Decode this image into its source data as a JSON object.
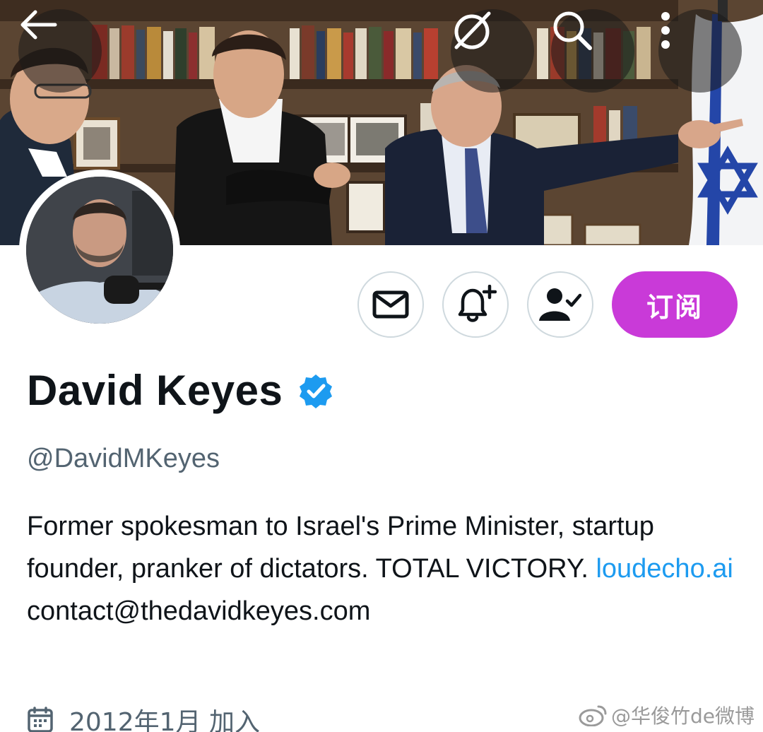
{
  "header": {
    "back_icon": "arrow-left-icon",
    "grok_icon": "grok-icon",
    "search_icon": "search-icon",
    "more_icon": "more-vertical-icon"
  },
  "actions": {
    "message_icon": "mail-icon",
    "notify_icon": "bell-plus-icon",
    "follow_icon": "person-check-icon",
    "subscribe_label": "订阅",
    "subscribe_color": "#c93ad8"
  },
  "profile": {
    "name": "David Keyes",
    "handle": "@DavidMKeyes",
    "verified_color": "#1d9bf0",
    "bio_text_1": "Former spokesman to Israel's Prime Minister, startup founder, pranker of dictators. TOTAL VICTORY. ",
    "bio_link": "loudecho.ai",
    "bio_text_2": " contact@thedavidkeyes.com",
    "joined": "2012年1月 加入"
  },
  "watermark": {
    "text": "@华俊竹de微博"
  }
}
